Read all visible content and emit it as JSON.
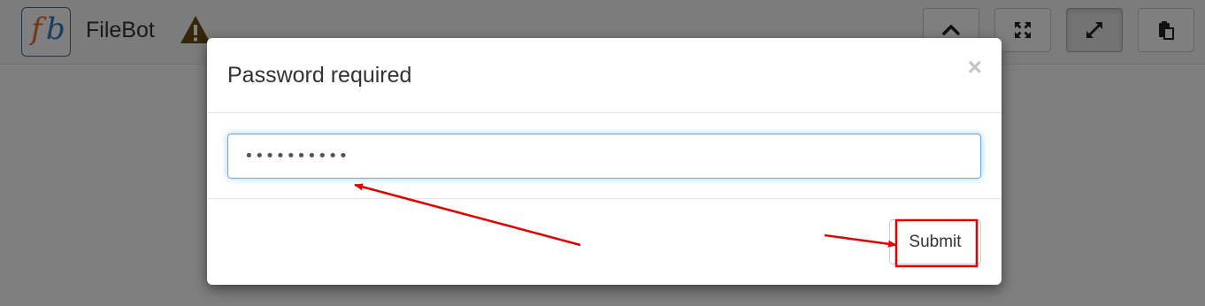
{
  "app": {
    "title": "FileBot",
    "logo_letters": {
      "first": "f",
      "second": "b"
    },
    "header_buttons": [
      {
        "icon": "chevron-up-icon"
      },
      {
        "icon": "expand-arrows-icon"
      },
      {
        "icon": "resize-diagonal-icon",
        "active": true
      },
      {
        "icon": "clipboard-icon"
      }
    ]
  },
  "modal": {
    "title": "Password required",
    "close_label": "×",
    "password_value": "••••••••••",
    "submit_label": "Submit"
  },
  "annotations": {
    "color": "#e00000"
  },
  "colors": {
    "input_focus_border": "#66afe9",
    "warning_icon": "#6b4a12",
    "overlay": "rgba(0,0,0,0.5)"
  }
}
